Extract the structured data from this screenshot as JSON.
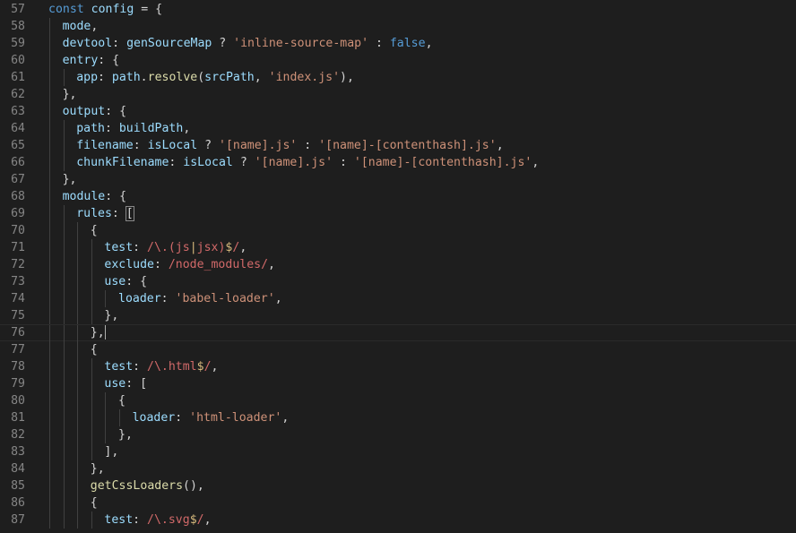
{
  "editor": {
    "language": "javascript",
    "cursor_line": 76,
    "colors": {
      "background": "#1e1e1e",
      "line_number": "#858585",
      "keyword": "#569cd6",
      "variable": "#9cdcfe",
      "function": "#dcdcaa",
      "string": "#ce9178",
      "regex": "#d16969",
      "regex_escape": "#d7ba7d",
      "text": "#d4d4d4"
    },
    "lines": [
      {
        "n": "57",
        "indent": 0,
        "tokens": [
          [
            "kw",
            "const"
          ],
          [
            "p",
            " "
          ],
          [
            "var",
            "config"
          ],
          [
            "p",
            " = {"
          ]
        ]
      },
      {
        "n": "58",
        "indent": 1,
        "tokens": [
          [
            "var",
            "mode"
          ],
          [
            "p",
            ","
          ]
        ]
      },
      {
        "n": "59",
        "indent": 1,
        "tokens": [
          [
            "var",
            "devtool"
          ],
          [
            "p",
            ": "
          ],
          [
            "var",
            "genSourceMap"
          ],
          [
            "p",
            " ? "
          ],
          [
            "str",
            "'inline-source-map'"
          ],
          [
            "p",
            " : "
          ],
          [
            "kw",
            "false"
          ],
          [
            "p",
            ","
          ]
        ]
      },
      {
        "n": "60",
        "indent": 1,
        "tokens": [
          [
            "var",
            "entry"
          ],
          [
            "p",
            ": {"
          ]
        ]
      },
      {
        "n": "61",
        "indent": 2,
        "tokens": [
          [
            "var",
            "app"
          ],
          [
            "p",
            ": "
          ],
          [
            "var",
            "path"
          ],
          [
            "p",
            "."
          ],
          [
            "fn",
            "resolve"
          ],
          [
            "p",
            "("
          ],
          [
            "var",
            "srcPath"
          ],
          [
            "p",
            ", "
          ],
          [
            "str",
            "'index.js'"
          ],
          [
            "p",
            "),"
          ]
        ]
      },
      {
        "n": "62",
        "indent": 1,
        "tokens": [
          [
            "p",
            "},"
          ]
        ]
      },
      {
        "n": "63",
        "indent": 1,
        "tokens": [
          [
            "var",
            "output"
          ],
          [
            "p",
            ": {"
          ]
        ]
      },
      {
        "n": "64",
        "indent": 2,
        "tokens": [
          [
            "var",
            "path"
          ],
          [
            "p",
            ": "
          ],
          [
            "var",
            "buildPath"
          ],
          [
            "p",
            ","
          ]
        ]
      },
      {
        "n": "65",
        "indent": 2,
        "tokens": [
          [
            "var",
            "filename"
          ],
          [
            "p",
            ": "
          ],
          [
            "var",
            "isLocal"
          ],
          [
            "p",
            " ? "
          ],
          [
            "str",
            "'[name].js'"
          ],
          [
            "p",
            " : "
          ],
          [
            "str",
            "'[name]-[contenthash].js'"
          ],
          [
            "p",
            ","
          ]
        ]
      },
      {
        "n": "66",
        "indent": 2,
        "tokens": [
          [
            "var",
            "chunkFilename"
          ],
          [
            "p",
            ": "
          ],
          [
            "var",
            "isLocal"
          ],
          [
            "p",
            " ? "
          ],
          [
            "str",
            "'[name].js'"
          ],
          [
            "p",
            " : "
          ],
          [
            "str",
            "'[name]-[contenthash].js'"
          ],
          [
            "p",
            ","
          ]
        ]
      },
      {
        "n": "67",
        "indent": 1,
        "tokens": [
          [
            "p",
            "},"
          ]
        ]
      },
      {
        "n": "68",
        "indent": 1,
        "tokens": [
          [
            "var",
            "module"
          ],
          [
            "p",
            ": {"
          ]
        ]
      },
      {
        "n": "69",
        "indent": 2,
        "tokens": [
          [
            "var",
            "rules"
          ],
          [
            "p",
            ": "
          ],
          [
            "bm",
            "["
          ]
        ]
      },
      {
        "n": "70",
        "indent": 3,
        "tokens": [
          [
            "p",
            "{"
          ]
        ]
      },
      {
        "n": "71",
        "indent": 4,
        "tokens": [
          [
            "var",
            "test"
          ],
          [
            "p",
            ": "
          ],
          [
            "re",
            "/\\.(js"
          ],
          [
            "re2",
            "|"
          ],
          [
            "re",
            "jsx)"
          ],
          [
            "re2",
            "$"
          ],
          [
            "re",
            "/"
          ],
          [
            "p",
            ","
          ]
        ]
      },
      {
        "n": "72",
        "indent": 4,
        "tokens": [
          [
            "var",
            "exclude"
          ],
          [
            "p",
            ": "
          ],
          [
            "re",
            "/node_modules/"
          ],
          [
            "p",
            ","
          ]
        ]
      },
      {
        "n": "73",
        "indent": 4,
        "tokens": [
          [
            "var",
            "use"
          ],
          [
            "p",
            ": {"
          ]
        ]
      },
      {
        "n": "74",
        "indent": 5,
        "tokens": [
          [
            "var",
            "loader"
          ],
          [
            "p",
            ": "
          ],
          [
            "str",
            "'babel-loader'"
          ],
          [
            "p",
            ","
          ]
        ]
      },
      {
        "n": "75",
        "indent": 4,
        "tokens": [
          [
            "p",
            "},"
          ]
        ]
      },
      {
        "n": "76",
        "indent": 3,
        "tokens": [
          [
            "p",
            "},"
          ],
          [
            "cur",
            ""
          ]
        ]
      },
      {
        "n": "77",
        "indent": 3,
        "tokens": [
          [
            "p",
            "{"
          ]
        ]
      },
      {
        "n": "78",
        "indent": 4,
        "tokens": [
          [
            "var",
            "test"
          ],
          [
            "p",
            ": "
          ],
          [
            "re",
            "/\\.html"
          ],
          [
            "re2",
            "$"
          ],
          [
            "re",
            "/"
          ],
          [
            "p",
            ","
          ]
        ]
      },
      {
        "n": "79",
        "indent": 4,
        "tokens": [
          [
            "var",
            "use"
          ],
          [
            "p",
            ": ["
          ]
        ]
      },
      {
        "n": "80",
        "indent": 5,
        "tokens": [
          [
            "p",
            "{"
          ]
        ]
      },
      {
        "n": "81",
        "indent": 6,
        "tokens": [
          [
            "var",
            "loader"
          ],
          [
            "p",
            ": "
          ],
          [
            "str",
            "'html-loader'"
          ],
          [
            "p",
            ","
          ]
        ]
      },
      {
        "n": "82",
        "indent": 5,
        "tokens": [
          [
            "p",
            "},"
          ]
        ]
      },
      {
        "n": "83",
        "indent": 4,
        "tokens": [
          [
            "p",
            "],"
          ]
        ]
      },
      {
        "n": "84",
        "indent": 3,
        "tokens": [
          [
            "p",
            "},"
          ]
        ]
      },
      {
        "n": "85",
        "indent": 3,
        "tokens": [
          [
            "fn",
            "getCssLoaders"
          ],
          [
            "p",
            "(),"
          ]
        ]
      },
      {
        "n": "86",
        "indent": 3,
        "tokens": [
          [
            "p",
            "{"
          ]
        ]
      },
      {
        "n": "87",
        "indent": 4,
        "tokens": [
          [
            "var",
            "test"
          ],
          [
            "p",
            ": "
          ],
          [
            "re",
            "/\\.svg"
          ],
          [
            "re2",
            "$"
          ],
          [
            "re",
            "/"
          ],
          [
            "p",
            ","
          ]
        ]
      }
    ]
  }
}
